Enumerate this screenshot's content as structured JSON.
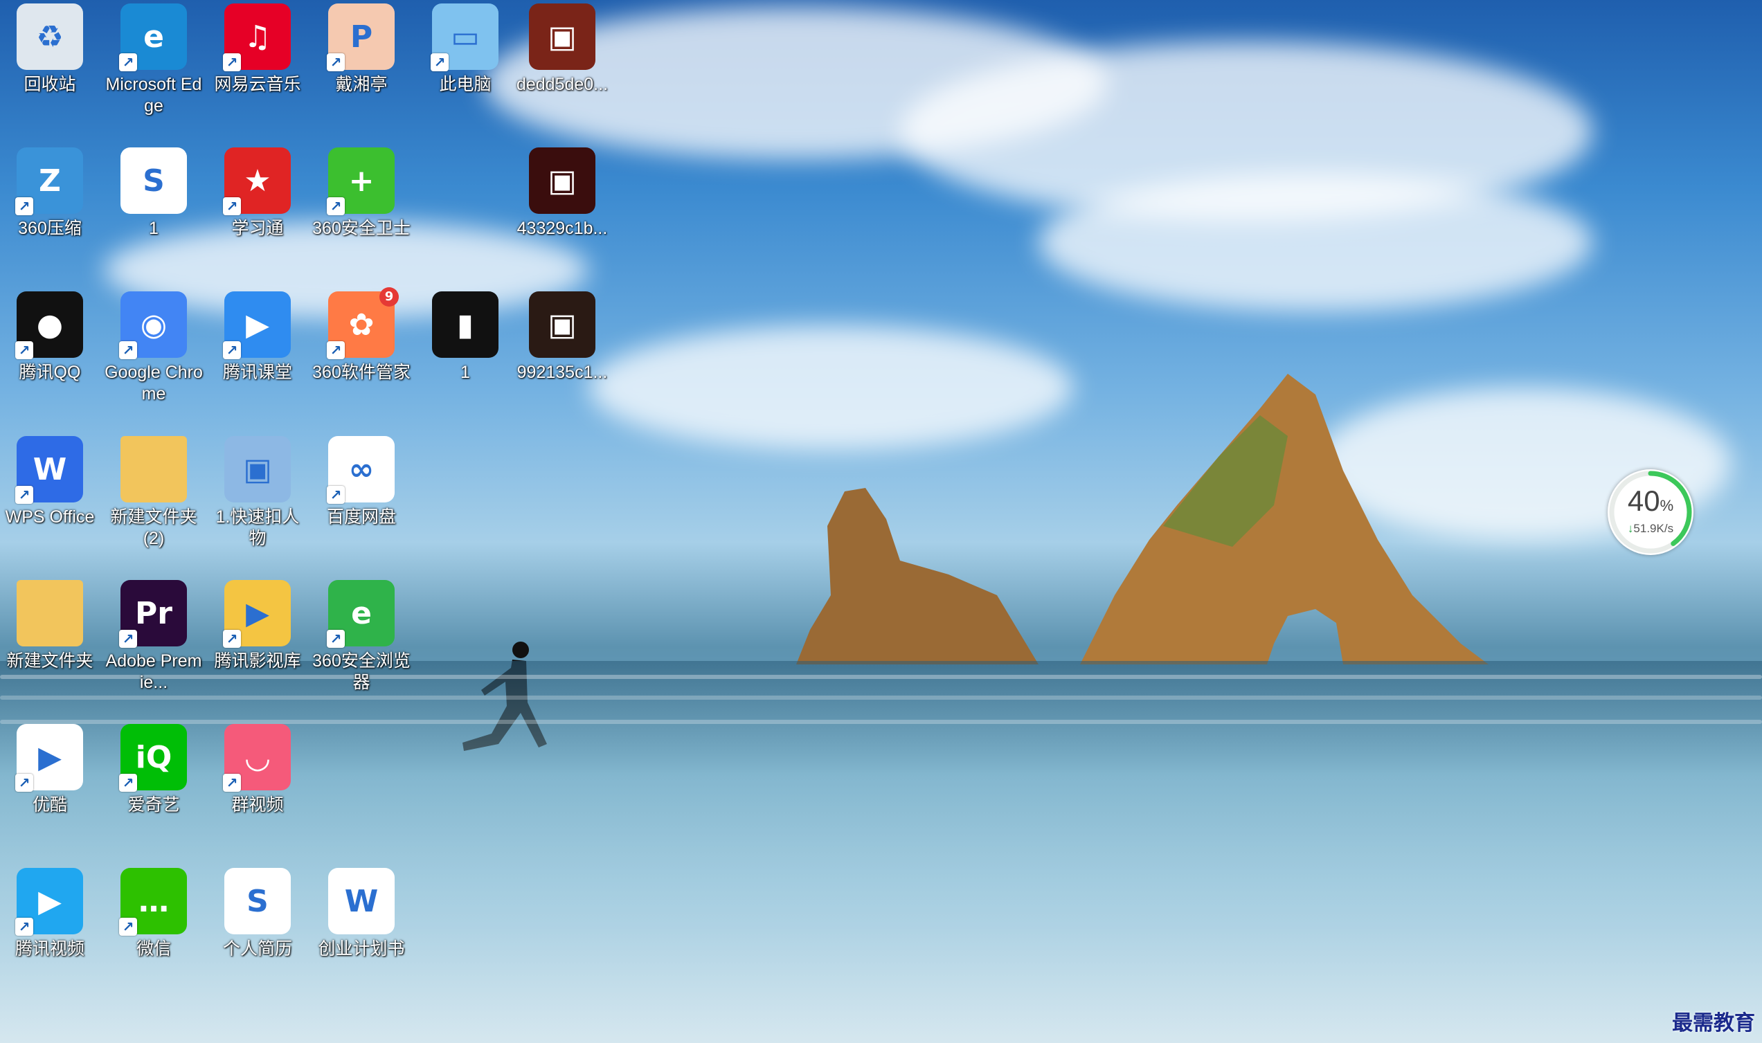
{
  "desktop_icons": [
    {
      "label": "回收站",
      "icon": "recycle-bin-icon",
      "color": "#dfe7ee",
      "shortcut": false
    },
    {
      "label": "Microsoft Edge",
      "icon": "edge-icon",
      "color": "#1a8ad4",
      "shortcut": true
    },
    {
      "label": "网易云音乐",
      "icon": "netease-music-icon",
      "color": "#e60026",
      "shortcut": true
    },
    {
      "label": "戴湘亭",
      "icon": "pdf-file-icon",
      "color": "#f5c9b0",
      "shortcut": true
    },
    {
      "label": "此电脑",
      "icon": "this-pc-icon",
      "color": "#7fc2ef",
      "shortcut": true
    },
    {
      "label": "dedd5de0...",
      "icon": "image-file-icon",
      "color": "#7a2418",
      "shortcut": false
    },
    {
      "label": "360压缩",
      "icon": "zip-360-icon",
      "color": "#3a93d9",
      "shortcut": true
    },
    {
      "label": "1",
      "icon": "spreadsheet-file-icon",
      "color": "#ffffff",
      "shortcut": false
    },
    {
      "label": "学习通",
      "icon": "xuexitong-icon",
      "color": "#e02424",
      "shortcut": true
    },
    {
      "label": "360安全卫士",
      "icon": "360-security-icon",
      "color": "#3cbf2f",
      "shortcut": true
    },
    {
      "label": "43329c1b...",
      "icon": "image-file-icon",
      "color": "#3a0d0d",
      "shortcut": false
    },
    {
      "label": "腾讯QQ",
      "icon": "qq-penguin-icon",
      "color": "#111111",
      "shortcut": true
    },
    {
      "label": "Google Chrome",
      "icon": "chrome-icon",
      "color": "#4285f4",
      "shortcut": true
    },
    {
      "label": "腾讯课堂",
      "icon": "tencent-classroom-icon",
      "color": "#2f8cf0",
      "shortcut": true
    },
    {
      "label": "360软件管家",
      "icon": "360-software-manager-icon",
      "color": "#ff7a45",
      "shortcut": true,
      "badge": "9"
    },
    {
      "label": "1",
      "icon": "video-file-icon",
      "color": "#111111",
      "shortcut": false
    },
    {
      "label": "992135c1...",
      "icon": "image-file-icon",
      "color": "#2a1a14",
      "shortcut": false
    },
    {
      "label": "WPS Office",
      "icon": "wps-office-icon",
      "color": "#2e6be6",
      "shortcut": true
    },
    {
      "label": "新建文件夹 (2)",
      "icon": "folder-icon",
      "color": "#f2c55c",
      "shortcut": false
    },
    {
      "label": "1.快速扣人物",
      "icon": "image-file-icon",
      "color": "#8db8e4",
      "shortcut": false
    },
    {
      "label": "百度网盘",
      "icon": "baidu-netdisk-icon",
      "color": "#ffffff",
      "shortcut": true
    },
    {
      "label": "新建文件夹",
      "icon": "folder-icon",
      "color": "#f2c55c",
      "shortcut": false
    },
    {
      "label": "Adobe Premie...",
      "icon": "premiere-icon",
      "color": "#2a0a3a",
      "shortcut": true
    },
    {
      "label": "腾讯影视库",
      "icon": "tencent-video-library-icon",
      "color": "#f4c542",
      "shortcut": true
    },
    {
      "label": "360安全浏览器",
      "icon": "360-browser-icon",
      "color": "#2fb34a",
      "shortcut": true
    },
    {
      "label": "优酷",
      "icon": "youku-icon",
      "color": "#ffffff",
      "shortcut": true
    },
    {
      "label": "爱奇艺",
      "icon": "iqiyi-icon",
      "color": "#00be06",
      "shortcut": true
    },
    {
      "label": "群视频",
      "icon": "group-video-icon",
      "color": "#f55a7a",
      "shortcut": true
    },
    {
      "label": "腾讯视频",
      "icon": "tencent-video-icon",
      "color": "#20a7f0",
      "shortcut": true
    },
    {
      "label": "微信",
      "icon": "wechat-icon",
      "color": "#2dc100",
      "shortcut": true
    },
    {
      "label": "个人简历",
      "icon": "spreadsheet-file-icon",
      "color": "#ffffff",
      "shortcut": false
    },
    {
      "label": "创业计划书",
      "icon": "word-file-icon",
      "color": "#ffffff",
      "shortcut": false
    }
  ],
  "speed_widget": {
    "percent": "40",
    "percent_unit": "%",
    "rate": "51.9K/s",
    "direction_icon": "download-arrow-icon",
    "level": 0.4,
    "accent": "#3cc85a"
  },
  "watermark": "最需教育"
}
